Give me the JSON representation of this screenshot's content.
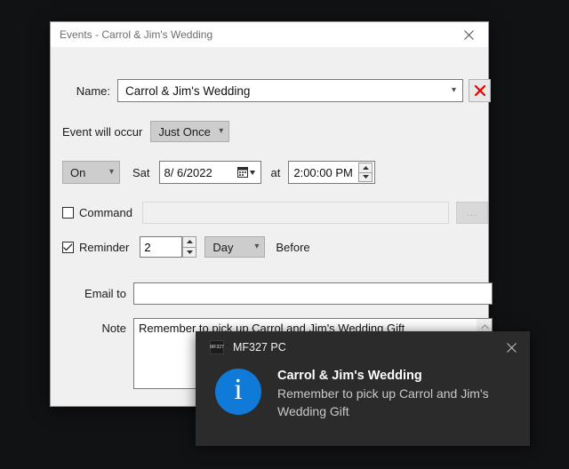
{
  "dialog": {
    "title": "Events - Carrol & Jim's Wedding",
    "close_icon": "close-icon",
    "name": {
      "label": "Name:",
      "value": "Carrol & Jim's Wedding",
      "dropdown_icon": "chevron-down-icon",
      "delete_icon": "red-x-delete-icon"
    },
    "occur": {
      "label": "Event will occur",
      "value": "Just Once",
      "dropdown_icon": "chevron-down-icon"
    },
    "when": {
      "mode": "On",
      "mode_dropdown_icon": "chevron-down-icon",
      "weekday": "Sat",
      "date": "8/  6/2022",
      "calendar_icon": "calendar-icon",
      "date_dropdown_icon": "chevron-down-icon",
      "at_label": "at",
      "time": "2:00:00 PM",
      "spin_up_icon": "spinner-up-icon",
      "spin_down_icon": "spinner-down-icon"
    },
    "command": {
      "label": "Command",
      "checked": false,
      "value": "",
      "browse_label": "...",
      "checkbox_icon": "checkbox-unchecked-icon"
    },
    "reminder": {
      "label": "Reminder",
      "checked": true,
      "checkbox_icon": "checkbox-checked-icon",
      "amount": "2",
      "unit": "Day",
      "unit_dropdown_icon": "chevron-down-icon",
      "suffix": "Before",
      "spin_up_icon": "spinner-up-icon",
      "spin_down_icon": "spinner-down-icon"
    },
    "email": {
      "label": "Email to",
      "value": ""
    },
    "note": {
      "label": "Note",
      "value": "Remember to pick up Carrol and Jim's Wedding Gift",
      "scroll_up_icon": "scroll-up-arrow-icon"
    }
  },
  "toast": {
    "app_icon_text": "MF327",
    "app_name": "MF327 PC",
    "close_icon": "close-icon",
    "info_icon": "info-icon",
    "info_glyph": "i",
    "title": "Carrol & Jim's Wedding",
    "message": "Remember to pick up Carrol and Jim's Wedding Gift"
  },
  "colors": {
    "accent_blue": "#0f7ad8",
    "delete_red": "#e50000",
    "desktop_background": "#111214",
    "dialog_background": "#f0f0f0",
    "toast_background": "#2b2b2b"
  }
}
